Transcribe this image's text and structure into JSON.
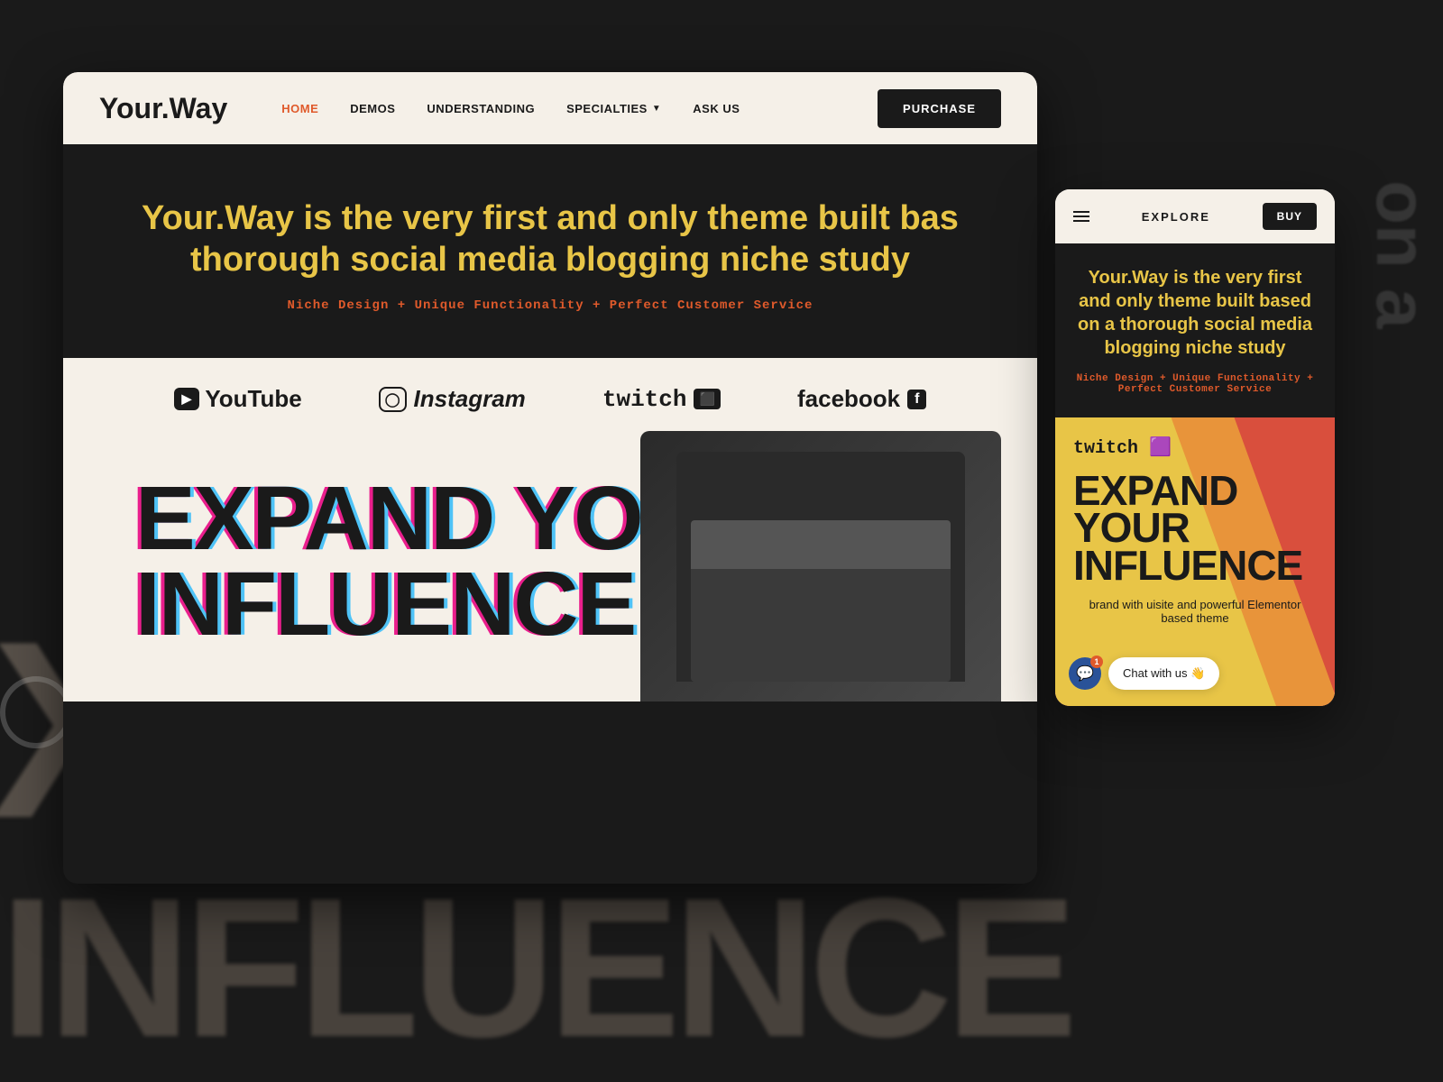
{
  "background": {
    "color": "#1a1a1a"
  },
  "bg_text": {
    "left_big": "INFLUENCE",
    "right_vertical": "on a",
    "x_text": "X"
  },
  "navbar": {
    "logo": "Your.Way",
    "links": [
      {
        "label": "HOME",
        "active": true
      },
      {
        "label": "DEMOS",
        "active": false
      },
      {
        "label": "UNDERSTANDING",
        "active": false
      },
      {
        "label": "SPECIALTIES",
        "active": false,
        "has_dropdown": true
      },
      {
        "label": "ASK US",
        "active": false
      }
    ],
    "purchase_label": "PURCHASE"
  },
  "hero": {
    "title": "Your.Way is the very first and only theme built bas thorough social media blogging niche study",
    "subtitle": "Niche Design + Unique Functionality + Perfect Customer Service"
  },
  "social_items": [
    {
      "icon": "▶",
      "label": "YouTube",
      "icon_type": "youtube"
    },
    {
      "icon": "○",
      "label": "Instagram",
      "icon_type": "instagram"
    },
    {
      "icon": "⬛",
      "label": "twitch",
      "icon_type": "twitch"
    },
    {
      "icon": "f",
      "label": "facebook",
      "icon_type": "facebook"
    }
  ],
  "expand_section": {
    "line1": "EXPAND YOUR",
    "line2": "INFLUENCE"
  },
  "mobile_card": {
    "header": {
      "explore_label": "EXPLORE",
      "buy_label": "BUY"
    },
    "hero": {
      "title": "Your.Way is the very first and only theme built based on a thorough social media blogging niche study",
      "subtitle": "Niche Design + Unique Functionality + Perfect Customer Service"
    },
    "diagonal_section": {
      "twitch_label": "twitch 🟪",
      "expand_line1": "EXPAND YOUR",
      "expand_line2": "INFLUENCE",
      "sub_text": "brand with uisite and powerful Elementor based theme"
    }
  },
  "chat_widget": {
    "badge": "1",
    "text": "Chat with us 👋"
  }
}
